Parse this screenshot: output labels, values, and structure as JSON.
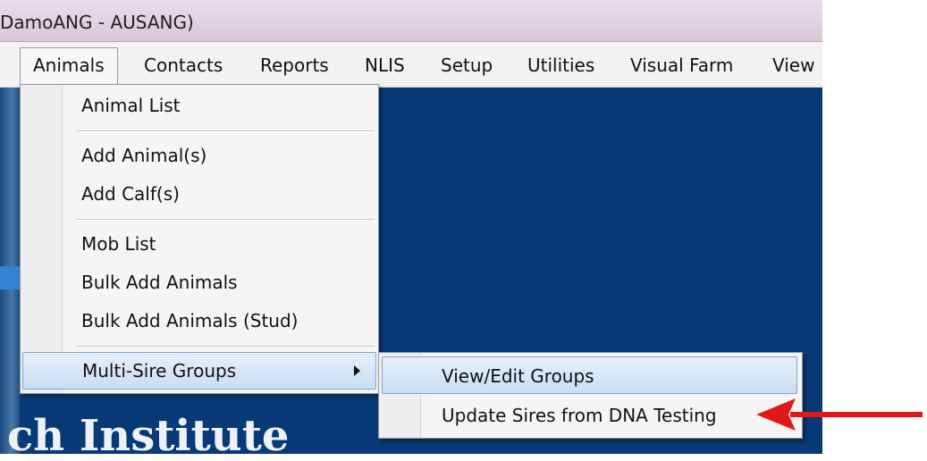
{
  "window": {
    "title": "DamoANG - AUSANG)"
  },
  "menubar": {
    "items": [
      {
        "label": "Animals"
      },
      {
        "label": "Contacts"
      },
      {
        "label": "Reports"
      },
      {
        "label": "NLIS"
      },
      {
        "label": "Setup"
      },
      {
        "label": "Utilities"
      },
      {
        "label": "Visual Farm"
      },
      {
        "label": "View"
      }
    ]
  },
  "animals_menu": {
    "items": [
      {
        "label": "Animal List"
      },
      {
        "label": "Add Animal(s)"
      },
      {
        "label": "Add Calf(s)"
      },
      {
        "label": "Mob List"
      },
      {
        "label": "Bulk Add Animals"
      },
      {
        "label": "Bulk Add Animals (Stud)"
      },
      {
        "label": "Multi-Sire Groups"
      }
    ]
  },
  "multi_sire_submenu": {
    "items": [
      {
        "label": "View/Edit Groups"
      },
      {
        "label": "Update Sires from DNA Testing"
      }
    ]
  },
  "background": {
    "banner_text": "ch Institute"
  },
  "colors": {
    "workarea": "#073a76",
    "highlight": "#c9ddf5",
    "annotation_arrow": "#e01818"
  }
}
